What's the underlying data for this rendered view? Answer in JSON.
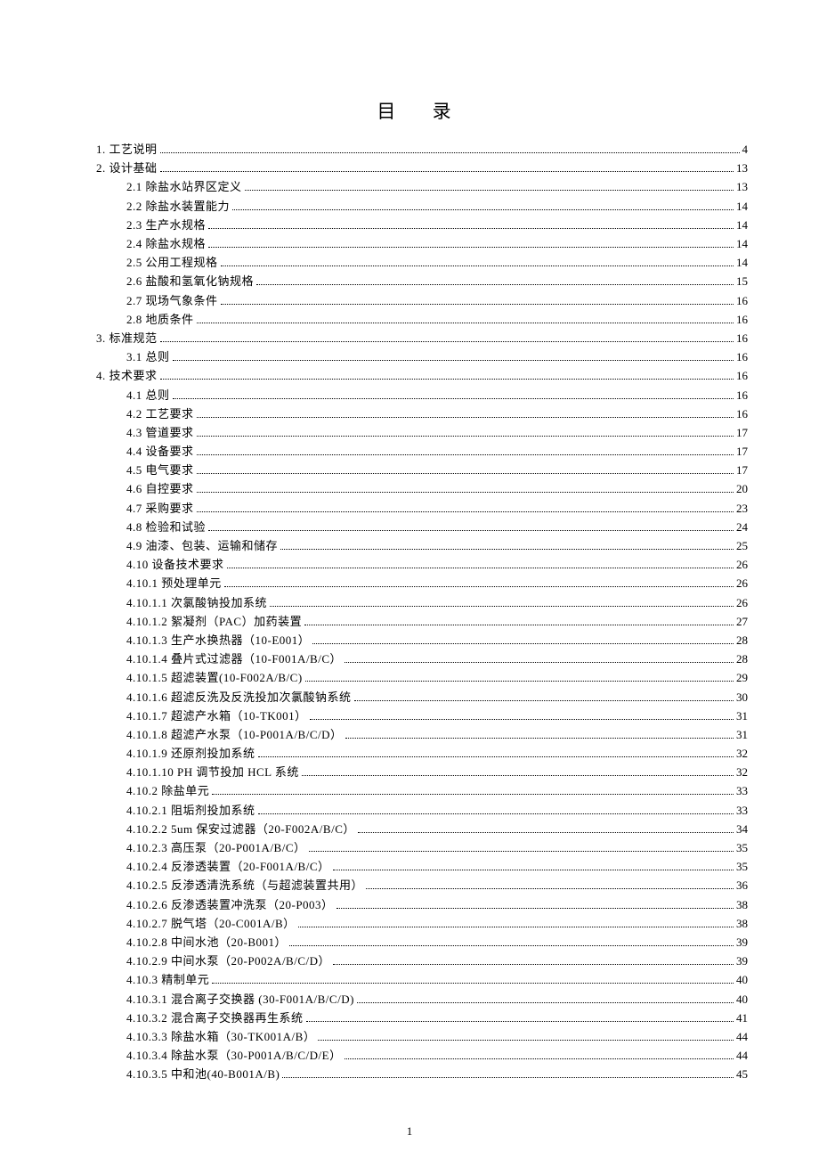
{
  "title": "目 录",
  "page_number": "1",
  "toc": [
    {
      "indent": 0,
      "label": "1. 工艺说明",
      "page": "4"
    },
    {
      "indent": 0,
      "label": "2.  设计基础",
      "page": "13"
    },
    {
      "indent": 1,
      "label": "2.1 除盐水站界区定义",
      "page": "13"
    },
    {
      "indent": 1,
      "label": "2.2 除盐水装置能力",
      "page": "14"
    },
    {
      "indent": 1,
      "label": "2.3 生产水规格",
      "page": "14"
    },
    {
      "indent": 1,
      "label": "2.4 除盐水规格",
      "page": "14"
    },
    {
      "indent": 1,
      "label": "2.5 公用工程规格",
      "page": "14"
    },
    {
      "indent": 1,
      "label": "2.6 盐酸和氢氧化钠规格",
      "page": "15"
    },
    {
      "indent": 1,
      "label": "2.7 现场气象条件",
      "page": "16"
    },
    {
      "indent": 1,
      "label": "2.8 地质条件",
      "page": "16"
    },
    {
      "indent": 0,
      "label": "3.  标准规范",
      "page": "16"
    },
    {
      "indent": 1,
      "label": "3.1 总则",
      "page": "16"
    },
    {
      "indent": 0,
      "label": "4.  技术要求",
      "page": "16"
    },
    {
      "indent": 1,
      "label": "4.1 总则",
      "page": "16"
    },
    {
      "indent": 1,
      "label": "4.2 工艺要求",
      "page": "16"
    },
    {
      "indent": 1,
      "label": "4.3 管道要求",
      "page": "17"
    },
    {
      "indent": 1,
      "label": "4.4 设备要求",
      "page": "17"
    },
    {
      "indent": 1,
      "label": "4.5 电气要求",
      "page": "17"
    },
    {
      "indent": 1,
      "label": "4.6 自控要求",
      "page": "20"
    },
    {
      "indent": 1,
      "label": "4.7 采购要求",
      "page": "23"
    },
    {
      "indent": 1,
      "label": "4.8 检验和试验",
      "page": "24"
    },
    {
      "indent": 1,
      "label": "4.9 油漆、包装、运输和储存",
      "page": "25"
    },
    {
      "indent": 1,
      "label": "4.10 设备技术要求",
      "page": "26"
    },
    {
      "indent": 1,
      "label": "4.10.1 预处理单元",
      "page": "26"
    },
    {
      "indent": 1,
      "label": "4.10.1.1 次氯酸钠投加系统",
      "page": "26"
    },
    {
      "indent": 1,
      "label": "4.10.1.2 絮凝剂（PAC）加药装置",
      "page": "27"
    },
    {
      "indent": 1,
      "label": "4.10.1.3 生产水换热器（10-E001）",
      "page": "28"
    },
    {
      "indent": 1,
      "label": "4.10.1.4 叠片式过滤器（10-F001A/B/C）",
      "page": "28"
    },
    {
      "indent": 1,
      "label": "4.10.1.5 超滤装置(10-F002A/B/C)",
      "page": "29"
    },
    {
      "indent": 1,
      "label": "4.10.1.6 超滤反洗及反洗投加次氯酸钠系统",
      "page": "30"
    },
    {
      "indent": 1,
      "label": "4.10.1.7 超滤产水箱（10-TK001）",
      "page": "31"
    },
    {
      "indent": 1,
      "label": "4.10.1.8 超滤产水泵（10-P001A/B/C/D）",
      "page": "31"
    },
    {
      "indent": 1,
      "label": "4.10.1.9 还原剂投加系统",
      "page": "32"
    },
    {
      "indent": 1,
      "label": "4.10.1.10 PH 调节投加 HCL 系统",
      "page": "32"
    },
    {
      "indent": 1,
      "label": "4.10.2 除盐单元",
      "page": "33"
    },
    {
      "indent": 1,
      "label": "4.10.2.1 阻垢剂投加系统",
      "page": "33"
    },
    {
      "indent": 1,
      "label": "4.10.2.2  5um 保安过滤器（20-F002A/B/C）",
      "page": "34"
    },
    {
      "indent": 1,
      "label": "4.10.2.3 高压泵（20-P001A/B/C）",
      "page": "35"
    },
    {
      "indent": 1,
      "label": "4.10.2.4 反渗透装置（20-F001A/B/C）",
      "page": "35"
    },
    {
      "indent": 1,
      "label": "4.10.2.5 反渗透清洗系统（与超滤装置共用）",
      "page": "36"
    },
    {
      "indent": 1,
      "label": "4.10.2.6 反渗透装置冲洗泵（20-P003）",
      "page": "38"
    },
    {
      "indent": 1,
      "label": "4.10.2.7 脱气塔（20-C001A/B）",
      "page": "38"
    },
    {
      "indent": 1,
      "label": "4.10.2.8 中间水池（20-B001）",
      "page": "39"
    },
    {
      "indent": 1,
      "label": "4.10.2.9 中间水泵（20-P002A/B/C/D）",
      "page": "39"
    },
    {
      "indent": 1,
      "label": "4.10.3 精制单元",
      "page": "40"
    },
    {
      "indent": 1,
      "label": "4.10.3.1 混合离子交换器 (30-F001A/B/C/D)",
      "page": "40"
    },
    {
      "indent": 1,
      "label": "4.10.3.2 混合离子交换器再生系统",
      "page": "41"
    },
    {
      "indent": 1,
      "label": "4.10.3.3 除盐水箱（30-TK001A/B）",
      "page": "44"
    },
    {
      "indent": 1,
      "label": "4.10.3.4 除盐水泵（30-P001A/B/C/D/E）",
      "page": "44"
    },
    {
      "indent": 1,
      "label": "4.10.3.5 中和池(40-B001A/B)",
      "page": "45"
    }
  ]
}
